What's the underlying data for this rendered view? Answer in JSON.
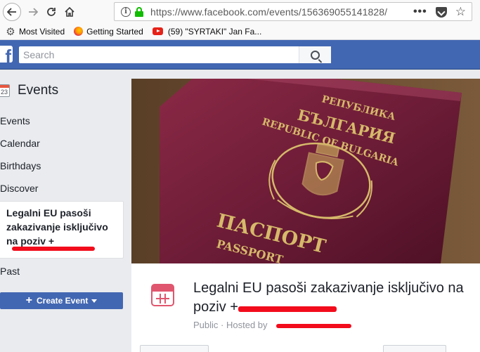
{
  "browser": {
    "url_host": "https://www.facebook.com",
    "url_path": "/events/156369055141828/",
    "more_label": "•••",
    "bookmarks": [
      {
        "label": "Most Visited",
        "icon": "gear-icon"
      },
      {
        "label": "Getting Started",
        "icon": "firefox-icon"
      },
      {
        "label": "(59) \"SYRTAKI\" Jan Fa...",
        "icon": "youtube-icon"
      }
    ]
  },
  "header": {
    "logo": "f",
    "search_placeholder": "Search"
  },
  "sidebar": {
    "title": "Events",
    "calendar_day": "23",
    "items": [
      {
        "label": "Events"
      },
      {
        "label": "Calendar"
      },
      {
        "label": "Birthdays"
      },
      {
        "label": "Discover"
      }
    ],
    "selected_event": "Legalni EU pasoši zakazivanje isključivo na poziv +",
    "past_label": "Past",
    "create_label": "Create Event"
  },
  "event": {
    "title": "Legalni EU pasoši zakazivanje isključivo na poziv +",
    "visibility": "Public",
    "hosted_by": "Hosted by"
  },
  "cover": {
    "republic_bg": "РЕПУБЛИКА",
    "country_bg": "БЪЛГАРИЯ",
    "republic_en": "REPUBLIC OF BULGARIA",
    "passport_bg": "ПАСПОРТ",
    "passport_en": "PASSPORT"
  },
  "colors": {
    "fb_blue": "#4267b2",
    "redaction": "#f20c1c",
    "event_icon": "#e0566e",
    "passport": "#7a1f3a",
    "gold": "#d6b96a"
  }
}
